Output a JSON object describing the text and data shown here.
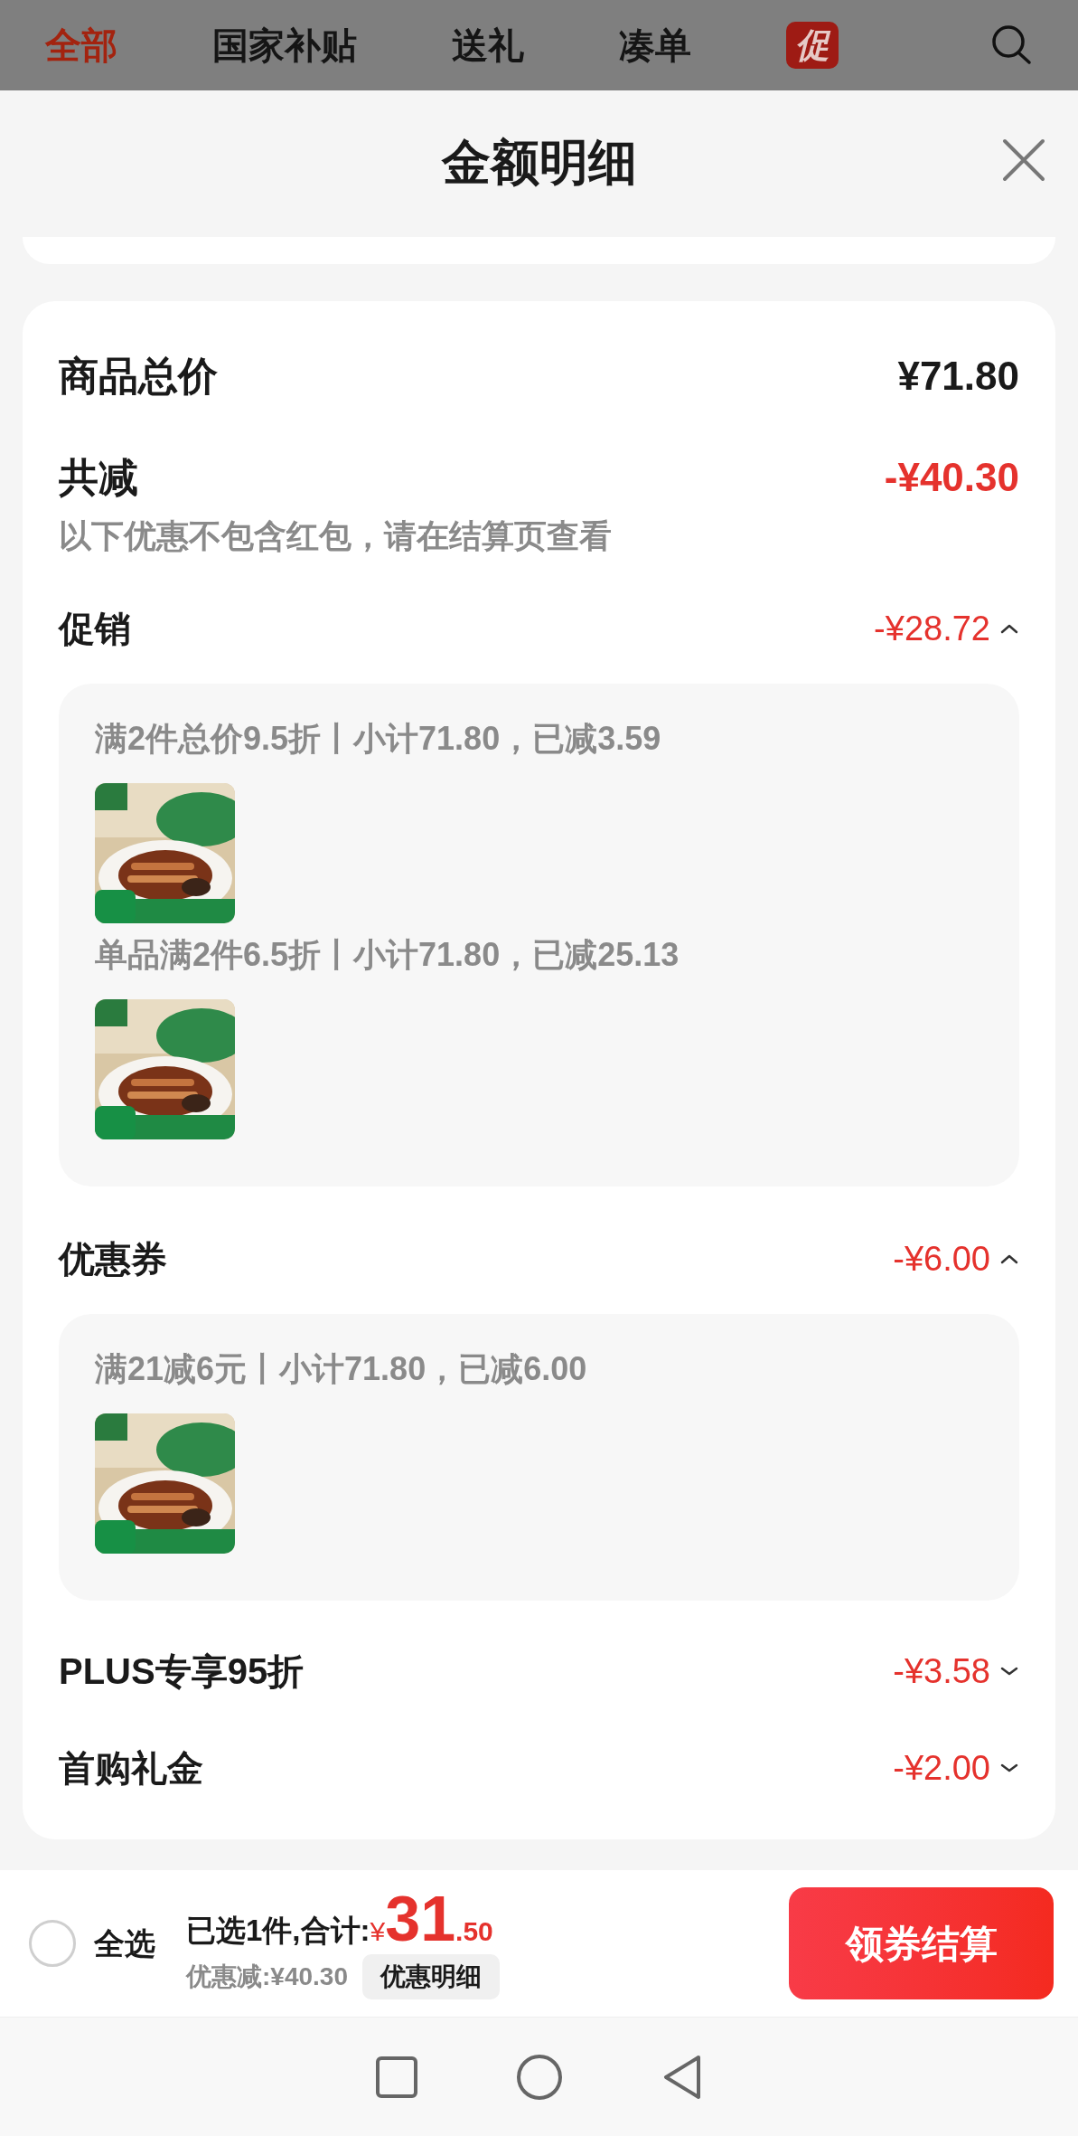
{
  "top_tabs": [
    {
      "label": "全部",
      "selected": true
    },
    {
      "label": "国家补贴",
      "selected": false
    },
    {
      "label": "送礼",
      "selected": false
    },
    {
      "label": "凑单",
      "selected": false
    }
  ],
  "promo_badge": "促",
  "sheet": {
    "title": "金额明细"
  },
  "summary": {
    "total_label": "商品总价",
    "total_value": "¥71.80",
    "reduce_label": "共减",
    "reduce_value": "-¥40.30",
    "note": "以下优惠不包含红包，请在结算页查看"
  },
  "sections": [
    {
      "label": "促销",
      "value": "-¥28.72",
      "expanded": true,
      "details": [
        {
          "text": "满2件总价9.5折丨小计71.80，已减3.59"
        },
        {
          "text": "单品满2件6.5折丨小计71.80，已减25.13"
        }
      ]
    },
    {
      "label": "优惠券",
      "value": "-¥6.00",
      "expanded": true,
      "details": [
        {
          "text": "满21减6元丨小计71.80，已减6.00"
        }
      ]
    },
    {
      "label": "PLUS专享95折",
      "value": "-¥3.58",
      "expanded": false
    },
    {
      "label": "首购礼金",
      "value": "-¥2.00",
      "expanded": false
    }
  ],
  "bottom_bar": {
    "select_all": {
      "label": "全选",
      "checked": false
    },
    "selected_text": "已选1件,合计:",
    "currency": "¥",
    "price_int": "31",
    "price_dec": ".50",
    "discount_text": "优惠减:¥40.30",
    "detail_button": "优惠明细",
    "checkout_button": "领券结算"
  }
}
